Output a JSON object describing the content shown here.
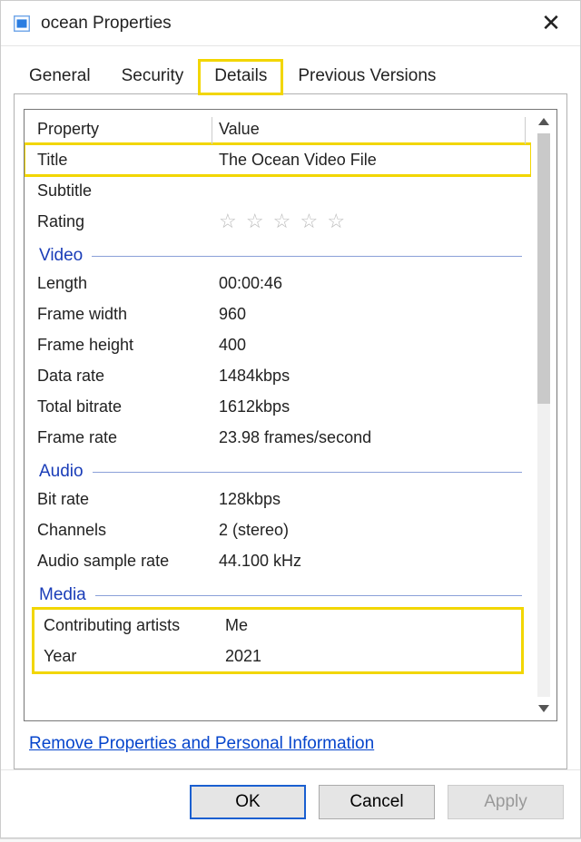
{
  "window": {
    "title": "ocean Properties"
  },
  "tabs": {
    "general": "General",
    "security": "Security",
    "details": "Details",
    "previous_versions": "Previous Versions"
  },
  "columns": {
    "property": "Property",
    "value": "Value"
  },
  "sections": {
    "video": "Video",
    "audio": "Audio",
    "media": "Media"
  },
  "props": {
    "title": {
      "label": "Title",
      "value": "The Ocean Video File"
    },
    "subtitle": {
      "label": "Subtitle",
      "value": ""
    },
    "rating": {
      "label": "Rating",
      "value": ""
    },
    "length": {
      "label": "Length",
      "value": "00:00:46"
    },
    "frame_width": {
      "label": "Frame width",
      "value": "960"
    },
    "frame_height": {
      "label": "Frame height",
      "value": "400"
    },
    "data_rate": {
      "label": "Data rate",
      "value": "1484kbps"
    },
    "total_bitrate": {
      "label": "Total bitrate",
      "value": "1612kbps"
    },
    "frame_rate": {
      "label": "Frame rate",
      "value": "23.98 frames/second"
    },
    "bit_rate": {
      "label": "Bit rate",
      "value": "128kbps"
    },
    "channels": {
      "label": "Channels",
      "value": "2 (stereo)"
    },
    "audio_sample_rate": {
      "label": "Audio sample rate",
      "value": "44.100 kHz"
    },
    "contributing_artists": {
      "label": "Contributing artists",
      "value": "Me"
    },
    "year": {
      "label": "Year",
      "value": "2021"
    }
  },
  "link": "Remove Properties and Personal Information",
  "buttons": {
    "ok": "OK",
    "cancel": "Cancel",
    "apply": "Apply"
  },
  "stars_glyph": "☆ ☆ ☆ ☆ ☆"
}
